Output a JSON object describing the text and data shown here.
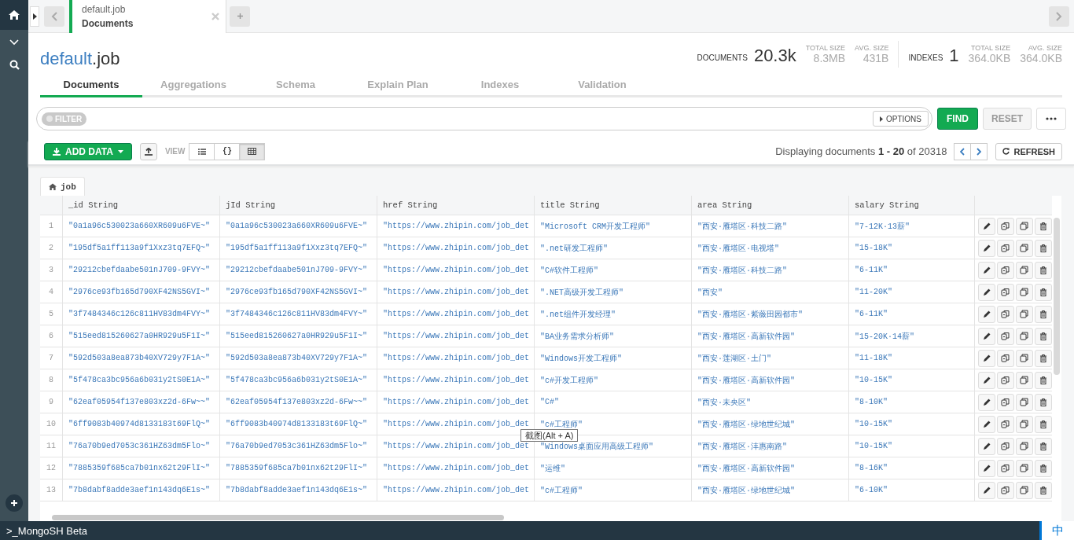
{
  "workspace_tabs": [
    {
      "namespace": "default.job",
      "view": "Documents",
      "selected": true
    }
  ],
  "header": {
    "database": "default",
    "collection": ".job"
  },
  "stats": {
    "documents": {
      "label": "DOCUMENTS",
      "value": "20.3k",
      "details": [
        {
          "label": "TOTAL SIZE",
          "value": "8.3MB"
        },
        {
          "label": "AVG. SIZE",
          "value": "431B"
        }
      ]
    },
    "indexes": {
      "label": "INDEXES",
      "value": "1",
      "details": [
        {
          "label": "TOTAL SIZE",
          "value": "364.0KB"
        },
        {
          "label": "AVG. SIZE",
          "value": "364.0KB"
        }
      ]
    }
  },
  "view_tabs": [
    {
      "label": "Documents",
      "selected": true
    },
    {
      "label": "Aggregations",
      "selected": false
    },
    {
      "label": "Schema",
      "selected": false
    },
    {
      "label": "Explain Plan",
      "selected": false
    },
    {
      "label": "Indexes",
      "selected": false
    },
    {
      "label": "Validation",
      "selected": false
    }
  ],
  "filter": {
    "label": "FILTER",
    "options": "OPTIONS",
    "find": "FIND",
    "reset": "RESET"
  },
  "toolbar": {
    "add_data": "ADD DATA",
    "view_label": "VIEW",
    "views": [
      {
        "kind": "list",
        "selected": false
      },
      {
        "kind": "json",
        "label": "{}",
        "selected": false
      },
      {
        "kind": "table",
        "selected": true
      }
    ],
    "pagination": "Displaying documents **1 - 20** of 20318",
    "refresh": "REFRESH"
  },
  "collection_tab": "job",
  "table": {
    "columns": [
      {
        "name": "_id",
        "type": "String"
      },
      {
        "name": "jId",
        "type": "String"
      },
      {
        "name": "href",
        "type": "String"
      },
      {
        "name": "title",
        "type": "String"
      },
      {
        "name": "area",
        "type": "String"
      },
      {
        "name": "salary",
        "type": "String"
      }
    ],
    "rows": [
      {
        "number": "1",
        "cells": [
          "\"0a1a96c530023a660XR609u6FVE~\"",
          "\"0a1a96c530023a660XR609u6FVE~\"",
          "\"https://www.zhipin.com/job_det",
          "\"Microsoft CRM开发工程师\"",
          "\"西安·雁塔区·科技二路\"",
          "\"7-12K·13薪\""
        ]
      },
      {
        "number": "2",
        "cells": [
          "\"195df5a1ff113a9f1Xxz3tq7EFQ~\"",
          "\"195df5a1ff113a9f1Xxz3tq7EFQ~\"",
          "\"https://www.zhipin.com/job_det",
          "\".net研发工程师\"",
          "\"西安·雁塔区·电视塔\"",
          "\"15-18K\""
        ]
      },
      {
        "number": "3",
        "cells": [
          "\"29212cbefdaabe501nJ709-9FVY~\"",
          "\"29212cbefdaabe501nJ709-9FVY~\"",
          "\"https://www.zhipin.com/job_det",
          "\"C#软件工程师\"",
          "\"西安·雁塔区·科技二路\"",
          "\"6-11K\""
        ]
      },
      {
        "number": "4",
        "cells": [
          "\"2976ce93fb165d790XF42NS5GVI~\"",
          "\"2976ce93fb165d790XF42NS5GVI~\"",
          "\"https://www.zhipin.com/job_det",
          "\".NET高级开发工程师\"",
          "\"西安\"",
          "\"11-20K\""
        ]
      },
      {
        "number": "5",
        "cells": [
          "\"3f7484346c126c811HV83dm4FVY~\"",
          "\"3f7484346c126c811HV83dm4FVY~\"",
          "\"https://www.zhipin.com/job_det",
          "\".net组件开发经理\"",
          "\"西安·雁塔区·紫薇田园都市\"",
          "\"6-11K\""
        ]
      },
      {
        "number": "6",
        "cells": [
          "\"515eed815260627a0HR929u5F1I~\"",
          "\"515eed815260627a0HR929u5F1I~\"",
          "\"https://www.zhipin.com/job_det",
          "\"BA业务需求分析师\"",
          "\"西安·雁塔区·高新软件园\"",
          "\"15-20K·14薪\""
        ]
      },
      {
        "number": "7",
        "cells": [
          "\"592d503a8ea873b40XV729y7F1A~\"",
          "\"592d503a8ea873b40XV729y7F1A~\"",
          "\"https://www.zhipin.com/job_det",
          "\"Windows开发工程师\"",
          "\"西安·莲湖区·土门\"",
          "\"11-18K\""
        ]
      },
      {
        "number": "8",
        "cells": [
          "\"5f478ca3bc956a6b031y2tS0E1A~\"",
          "\"5f478ca3bc956a6b031y2tS0E1A~\"",
          "\"https://www.zhipin.com/job_det",
          "\"c#开发工程师\"",
          "\"西安·雁塔区·高新软件园\"",
          "\"10-15K\""
        ]
      },
      {
        "number": "9",
        "cells": [
          "\"62eaf05954f137e803xz2d-6Fw~~\"",
          "\"62eaf05954f137e803xz2d-6Fw~~\"",
          "\"https://www.zhipin.com/job_det",
          "\"C#\"",
          "\"西安·未央区\"",
          "\"8-10K\""
        ]
      },
      {
        "number": "10",
        "cells": [
          "\"6ff9083b40974d8133183t69FlQ~\"",
          "\"6ff9083b40974d8133183t69FlQ~\"",
          "\"https://www.zhipin.com/job_det",
          "\"c#工程师\"",
          "\"西安·雁塔区·绿地世纪城\"",
          "\"10-15K\""
        ]
      },
      {
        "number": "11",
        "cells": [
          "\"76a70b9ed7053c361HZ63dm5Flo~\"",
          "\"76a70b9ed7053c361HZ63dm5Flo~\"",
          "\"https://www.zhipin.com/job_det",
          "\"Windows桌面应用高级工程师\"",
          "\"西安·雁塔区·沣惠南路\"",
          "\"10-15K\""
        ]
      },
      {
        "number": "12",
        "cells": [
          "\"7885359f685ca7b01nx62t29FlI~\"",
          "\"7885359f685ca7b01nx62t29FlI~\"",
          "\"https://www.zhipin.com/job_det",
          "\"运维\"",
          "\"西安·雁塔区·高新软件园\"",
          "\"8-16K\""
        ]
      },
      {
        "number": "13",
        "cells": [
          "\"7b8dabf8adde3aef1n143dq6E1s~\"",
          "\"7b8dabf8adde3aef1n143dq6E1s~\"",
          "\"https://www.zhipin.com/job_det",
          "\"c#工程师\"",
          "\"西安·雁塔区·绿地世纪城\"",
          "\"6-10K\""
        ]
      }
    ]
  },
  "tooltip": "截图(Alt + A)",
  "shell_bar": ">_MongoSH Beta",
  "ime_indicator": "中"
}
